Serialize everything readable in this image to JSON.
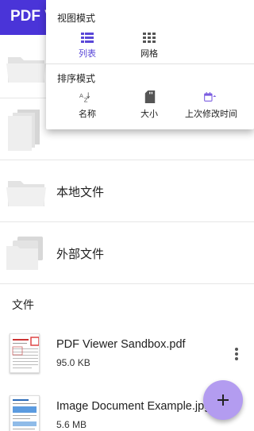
{
  "app": {
    "title": "PDF V"
  },
  "rows": [
    {
      "label": ""
    },
    {
      "label": ""
    },
    {
      "label": "本地文件"
    },
    {
      "label": "外部文件"
    }
  ],
  "files_section": {
    "title": "文件"
  },
  "files": [
    {
      "name": "PDF Viewer Sandbox.pdf",
      "size": "95.0 KB"
    },
    {
      "name": "Image Document Example.jpg",
      "size": "5.6 MB"
    }
  ],
  "menu": {
    "view_mode": {
      "title": "视图模式",
      "options": [
        {
          "label": "列表",
          "icon": "list-view-icon",
          "selected": true
        },
        {
          "label": "网格",
          "icon": "grid-view-icon",
          "selected": false
        }
      ]
    },
    "sort": {
      "title": "排序模式",
      "options": [
        {
          "label": "名称",
          "icon": "sort-az-icon"
        },
        {
          "label": "大小",
          "icon": "sd-card-icon"
        },
        {
          "label": "上次修改时间",
          "icon": "calendar-icon"
        }
      ]
    }
  },
  "colors": {
    "accent": "#4a34d8",
    "selected": "#5a47d8",
    "fab": "#b39cf0"
  }
}
